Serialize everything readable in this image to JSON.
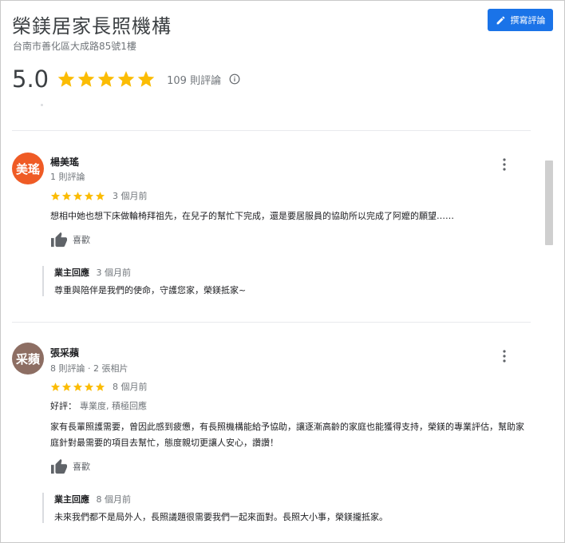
{
  "header": {
    "title": "榮鎂居家長照機構",
    "address": "台南市善化區大成路85號1樓",
    "write_review_label": "撰寫評論",
    "rating": "5.0",
    "star_count": 5,
    "review_count": "109 則評論",
    "star_color": "#fbbc04",
    "button_color": "#1a73e8"
  },
  "reviews": [
    {
      "avatar_text": "美瑤",
      "avatar_color": "#ef5b25",
      "name": "楊美瑤",
      "meta": "1 則評論",
      "stars": 5,
      "date": "3 個月前",
      "text": "想相中她也想下床做輪椅拜祖先，在兒子的幫忙下完成，還是要居服員的協助所以完成了阿嬤的願望……",
      "like_label": "喜歡",
      "reply": {
        "owner_label": "業主回應",
        "date": "3 個月前",
        "text": "尊重與陪伴是我們的使命，守護您家，榮鎂抵家~"
      }
    },
    {
      "avatar_text": "采蘋",
      "avatar_color": "#8d6e63",
      "name": "張采蘋",
      "meta": "8 則評論 · 2 張相片",
      "stars": 5,
      "date": "8 個月前",
      "attr_label": "好評：",
      "attr_value": "專業度, 積極回應",
      "text": "家有長輩照護需要，曾因此感到疲憊，有長照機構能給予協助，讓逐漸高齡的家庭也能獲得支持，榮鎂的專業評估，幫助家庭針對最需要的項目去幫忙，態度親切更讓人安心，讚讚！",
      "like_label": "喜歡",
      "reply": {
        "owner_label": "業主回應",
        "date": "8 個月前",
        "text": "未來我們都不是局外人，長照議題很需要我們一起來面對。長照大小事，榮鎂攏抵家。"
      }
    }
  ]
}
